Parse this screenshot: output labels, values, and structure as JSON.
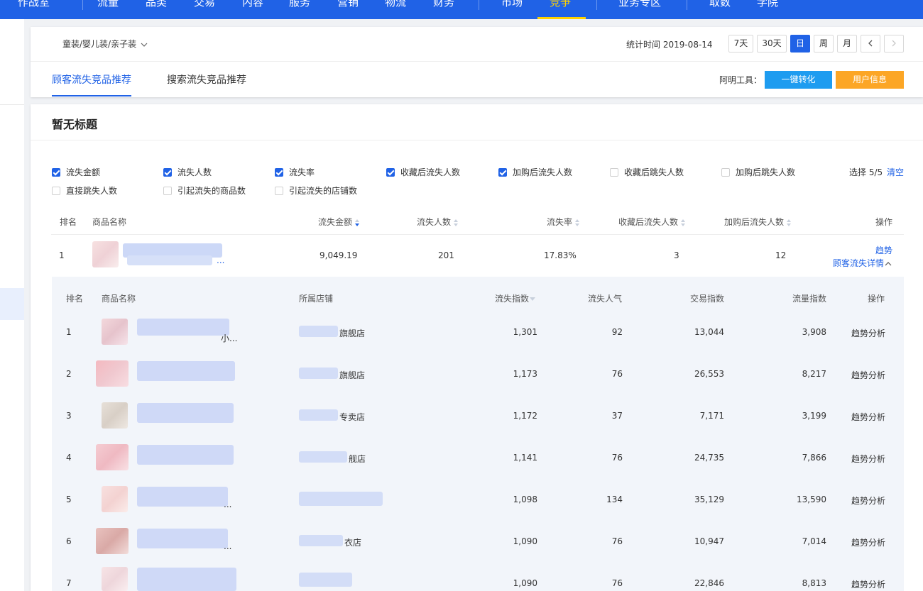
{
  "topnav": {
    "items": [
      "作战室",
      "流量",
      "品类",
      "交易",
      "内容",
      "服务",
      "营销",
      "物流",
      "财务",
      "市场",
      "竞争",
      "业务专区",
      "取数",
      "学院"
    ],
    "active_index": 10,
    "bg_color": "#2062e6",
    "active_color": "#ffd200"
  },
  "header": {
    "category": "童装/婴儿装/亲子装",
    "stat_label": "统计时间 2019-08-14",
    "periods": [
      "7天",
      "30天",
      "日",
      "周",
      "月"
    ],
    "active_period": "日",
    "prev_icon": "chevron-left-icon",
    "next_icon": "chevron-right-icon"
  },
  "tabs": {
    "items": [
      "顾客流失竞品推荐",
      "搜索流失竞品推荐"
    ],
    "active_index": 0
  },
  "tools": {
    "label": "阿明工具：",
    "convert_button": "一键转化",
    "user_info_button": "用户信息"
  },
  "section": {
    "title": "暂无标题"
  },
  "metrics": {
    "options": [
      {
        "label": "流失金额",
        "checked": true
      },
      {
        "label": "流失人数",
        "checked": true
      },
      {
        "label": "流失率",
        "checked": true
      },
      {
        "label": "收藏后流失人数",
        "checked": true
      },
      {
        "label": "加购后流失人数",
        "checked": true
      },
      {
        "label": "收藏后跳失人数",
        "checked": false
      },
      {
        "label": "加购后跳失人数",
        "checked": false
      },
      {
        "label": "直接跳失人数",
        "checked": false
      },
      {
        "label": "引起流失的商品数",
        "checked": false
      },
      {
        "label": "引起流失的店铺数",
        "checked": false
      }
    ],
    "selected_label": "选择 5/5",
    "clear_label": "清空"
  },
  "main_table": {
    "headers": [
      "排名",
      "商品名称",
      "流失金额",
      "流失人数",
      "流失率",
      "收藏后流失人数",
      "加购后流失人数",
      "操作"
    ],
    "rows": [
      {
        "rank": "1",
        "amount": "9,049.19",
        "people": "201",
        "rate": "17.83%",
        "fav_lost": "3",
        "cart_lost": "12",
        "trend_link": "趋势",
        "detail_link": "顾客流失详情",
        "title_suffix": "..."
      }
    ]
  },
  "sub_table": {
    "headers": [
      "排名",
      "商品名称",
      "所属店铺",
      "流失指数",
      "流失人气",
      "交易指数",
      "流量指数",
      "操作"
    ],
    "rows": [
      {
        "rank": "1",
        "name_frag": "小...",
        "shop_frag": "旗舰店",
        "loss_index": "1,301",
        "loss_pop": "92",
        "trade_index": "13,044",
        "traffic_index": "3,908",
        "action": "趋势分析"
      },
      {
        "rank": "2",
        "name_frag": "",
        "shop_frag": "旗舰店",
        "loss_index": "1,173",
        "loss_pop": "76",
        "trade_index": "26,553",
        "traffic_index": "8,217",
        "action": "趋势分析"
      },
      {
        "rank": "3",
        "name_frag": "",
        "shop_frag": "专卖店",
        "loss_index": "1,172",
        "loss_pop": "37",
        "trade_index": "7,171",
        "traffic_index": "3,199",
        "action": "趋势分析"
      },
      {
        "rank": "4",
        "name_frag": "",
        "shop_frag": "舰店",
        "loss_index": "1,141",
        "loss_pop": "76",
        "trade_index": "24,735",
        "traffic_index": "7,866",
        "action": "趋势分析"
      },
      {
        "rank": "5",
        "name_frag": "...",
        "shop_frag": "",
        "loss_index": "1,098",
        "loss_pop": "134",
        "trade_index": "35,129",
        "traffic_index": "13,590",
        "action": "趋势分析"
      },
      {
        "rank": "6",
        "name_frag": "...",
        "shop_frag": "衣店",
        "loss_index": "1,090",
        "loss_pop": "76",
        "trade_index": "10,947",
        "traffic_index": "7,014",
        "action": "趋势分析"
      },
      {
        "rank": "7",
        "name_frag": "",
        "shop_frag": "",
        "loss_index": "1,090",
        "loss_pop": "76",
        "trade_index": "22,846",
        "traffic_index": "8,813",
        "action": "趋势分析"
      }
    ]
  }
}
